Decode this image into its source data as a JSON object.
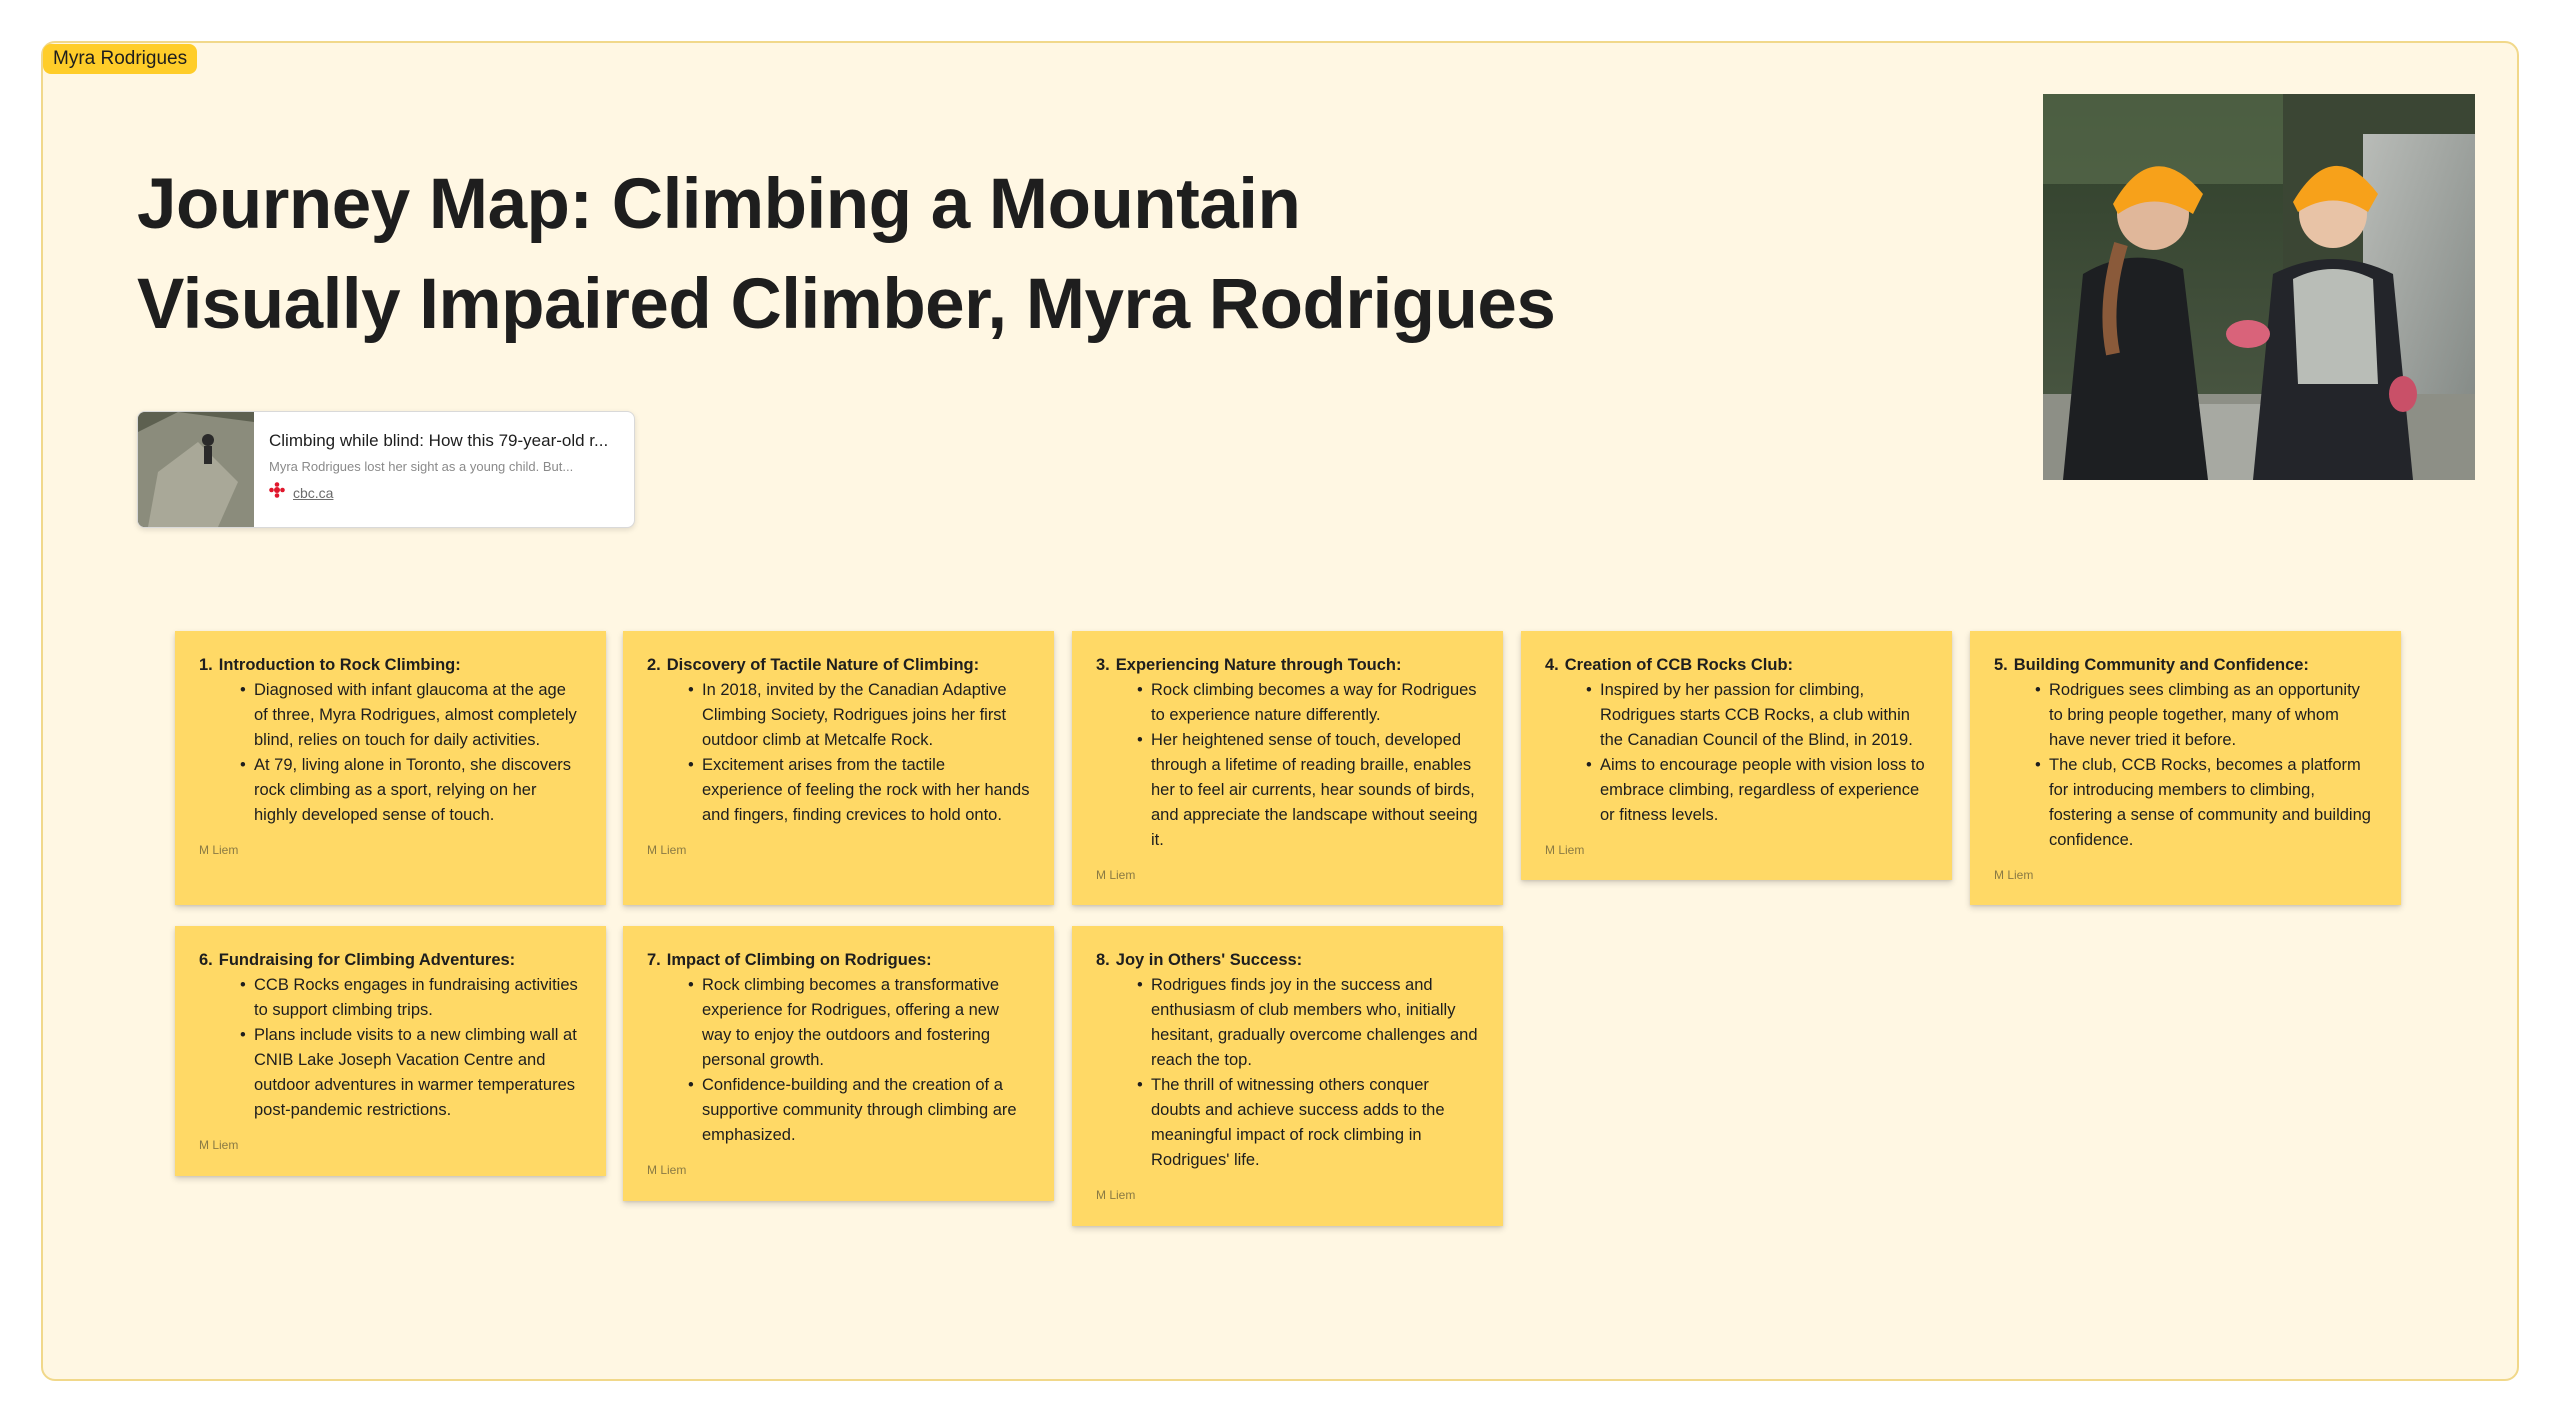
{
  "section": {
    "label": "Myra Rodrigues"
  },
  "title": {
    "line1": "Journey Map: Climbing a Mountain",
    "line2": "Visually Impaired Climber, Myra Rodrigues"
  },
  "link_card": {
    "title": "Climbing while blind: How this 79-year-old r...",
    "description": "Myra Rodrigues lost her sight as a young child. But...",
    "domain": "cbc.ca",
    "favicon": "cbc-gem-icon"
  },
  "colors": {
    "section_bg": "#fff7e3",
    "section_border": "#f1d88a",
    "label_bg": "#ffcd29",
    "sticky_bg": "#ffd966",
    "cbc_red": "#e0172d"
  },
  "stickies": [
    {
      "number": "1.",
      "title": "Introduction to Rock Climbing:",
      "bullets": [
        "Diagnosed with infant glaucoma at the age of three, Myra Rodrigues, almost completely blind, relies on touch for daily activities.",
        "At 79, living alone in Toronto, she discovers rock climbing as a sport, relying on her highly developed sense of touch."
      ],
      "author": "M Liem"
    },
    {
      "number": "2.",
      "title": "Discovery of Tactile Nature of Climbing:",
      "bullets": [
        "In 2018, invited by the Canadian Adaptive Climbing Society, Rodrigues joins her first outdoor climb at Metcalfe Rock.",
        "Excitement arises from the tactile experience of feeling the rock with her hands and fingers, finding crevices to hold onto."
      ],
      "author": "M Liem"
    },
    {
      "number": "3.",
      "title": "Experiencing Nature through Touch:",
      "bullets": [
        "Rock climbing becomes a way for Rodrigues to experience nature differently.",
        "Her heightened sense of touch, developed through a lifetime of reading braille, enables her to feel air currents, hear sounds of birds, and appreciate the landscape without seeing it."
      ],
      "author": "M Liem"
    },
    {
      "number": "4.",
      "title": "Creation of CCB Rocks Club:",
      "bullets": [
        "Inspired by her passion for climbing, Rodrigues starts CCB Rocks, a club within the Canadian Council of the Blind, in 2019.",
        "Aims to encourage people with vision loss to embrace climbing, regardless of experience or fitness levels."
      ],
      "author": "M Liem"
    },
    {
      "number": "5.",
      "title": "Building Community and Confidence:",
      "bullets": [
        "Rodrigues sees climbing as an opportunity to bring people together, many of whom have never tried it before.",
        "The club, CCB Rocks, becomes a platform for introducing members to climbing, fostering a sense of community and building confidence."
      ],
      "author": "M Liem"
    },
    {
      "number": "6.",
      "title": "Fundraising for Climbing Adventures:",
      "bullets": [
        "CCB Rocks engages in fundraising activities to support climbing trips.",
        "Plans include visits to a new climbing wall at CNIB Lake Joseph Vacation Centre and outdoor adventures in warmer temperatures post-pandemic restrictions."
      ],
      "author": "M Liem"
    },
    {
      "number": "7.",
      "title": "Impact of Climbing on Rodrigues:",
      "bullets": [
        "Rock climbing becomes a transformative experience for Rodrigues, offering a new way to enjoy the outdoors and fostering personal growth.",
        "Confidence-building and the creation of a supportive community through climbing are emphasized."
      ],
      "author": "M Liem"
    },
    {
      "number": "8.",
      "title": "Joy in Others' Success:",
      "bullets": [
        "Rodrigues finds joy in the success and enthusiasm of club members who, initially hesitant, gradually overcome challenges and reach the top.",
        "The thrill of witnessing others conquer doubts and achieve success adds to the meaningful impact of rock climbing in Rodrigues' life."
      ],
      "author": "M Liem"
    }
  ]
}
